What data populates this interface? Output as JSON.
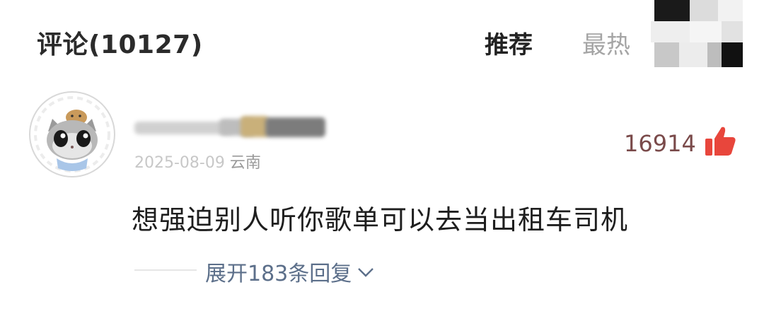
{
  "header": {
    "title": "评论(10127)",
    "tabs": [
      {
        "label": "推荐",
        "active": true
      },
      {
        "label": "最热",
        "active": false
      }
    ]
  },
  "comment": {
    "date": "2025-08-09",
    "date_visible_prefix": "·025-08-09",
    "location": "云南",
    "likes": "16914",
    "text": "想强迫别人听你歌单可以去当出租车司机",
    "expand_label": "展开183条回复",
    "username_obscured": true
  },
  "colors": {
    "like_red": "#e8463c",
    "reply_link": "#5c6f8a",
    "muted_text": "#a5a5a5"
  },
  "icons": {
    "like": "thumbs-up-icon",
    "expand": "chevron-down-icon"
  }
}
